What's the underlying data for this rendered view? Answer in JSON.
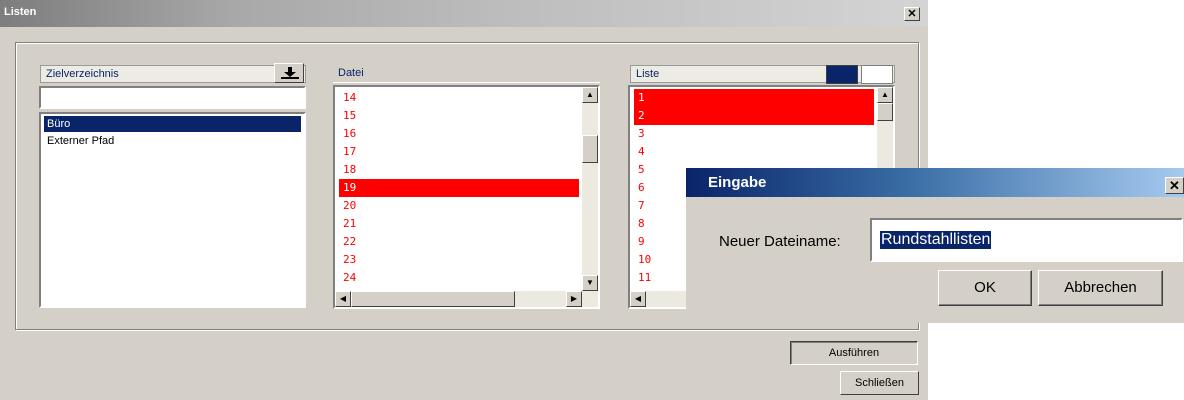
{
  "window": {
    "title": "Listen",
    "close_glyph": "✕"
  },
  "zielverzeichnis": {
    "label": "Zielverzeichnis",
    "button_icon": "download-icon",
    "input_value": "",
    "items": [
      {
        "label": "Büro",
        "selected": true
      },
      {
        "label": "Externer Pfad",
        "selected": false
      }
    ]
  },
  "datei": {
    "label": "Datei",
    "items": [
      {
        "label": "14",
        "selected": false
      },
      {
        "label": "15",
        "selected": false
      },
      {
        "label": "16",
        "selected": false
      },
      {
        "label": "17",
        "selected": false
      },
      {
        "label": "18",
        "selected": false
      },
      {
        "label": "19",
        "selected": true
      },
      {
        "label": "20",
        "selected": false
      },
      {
        "label": "21",
        "selected": false
      },
      {
        "label": "22",
        "selected": false
      },
      {
        "label": "23",
        "selected": false
      },
      {
        "label": "24",
        "selected": false
      }
    ]
  },
  "liste": {
    "label": "Liste",
    "colors": {
      "swatch_dark": "#0a246a",
      "swatch_light": "#ffffff"
    },
    "items": [
      {
        "label": "1",
        "selected": true
      },
      {
        "label": "2",
        "selected": true
      },
      {
        "label": "3",
        "selected": false
      },
      {
        "label": "4",
        "selected": false
      },
      {
        "label": "5",
        "selected": false
      },
      {
        "label": "6",
        "selected": false
      },
      {
        "label": "7",
        "selected": false
      },
      {
        "label": "8",
        "selected": false
      },
      {
        "label": "9",
        "selected": false
      },
      {
        "label": "10",
        "selected": false
      },
      {
        "label": "11",
        "selected": false
      }
    ]
  },
  "buttons": {
    "execute": "Ausführen",
    "close": "Schließen"
  },
  "dialog": {
    "title": "Eingabe",
    "close_glyph": "✕",
    "field_label": "Neuer Dateiname:",
    "field_value": "Rundstahllisten",
    "ok": "OK",
    "cancel": "Abbrechen"
  },
  "colors": {
    "selection_red": "#ff0000",
    "selection_navy": "#0a246a",
    "window_face": "#d4d0c8"
  }
}
